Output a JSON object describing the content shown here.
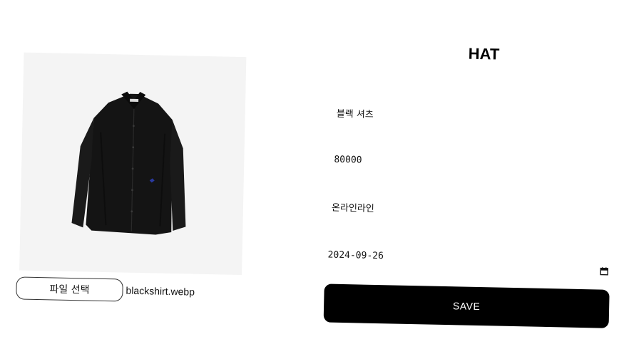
{
  "product_image": {
    "alt": "black shirt"
  },
  "file_input": {
    "button_label": "파일 선택",
    "file_name": "blackshirt.webp"
  },
  "form": {
    "title": "HAT",
    "name_value": "블랙 셔츠",
    "price_value": "80000",
    "channel_value": "온라인라인",
    "date_value": "2024-09-26",
    "save_label": "SAVE"
  },
  "colors": {
    "save_button_bg": "#000000",
    "save_button_text": "#ffffff",
    "image_bg": "#f4f4f4"
  },
  "icons": {
    "date_picker": "calendar-icon"
  }
}
